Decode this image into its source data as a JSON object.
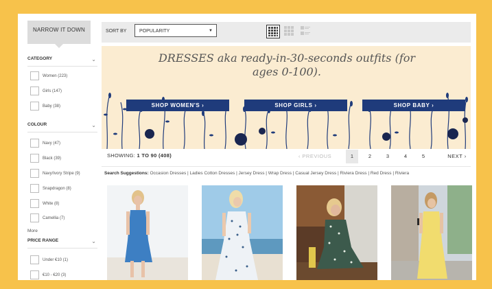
{
  "sidebar": {
    "narrow_title": "NARROW IT DOWN",
    "sections": [
      {
        "title": "CATEGORY",
        "options": [
          "Women (223)",
          "Girls (147)",
          "Baby (38)"
        ]
      },
      {
        "title": "COLOUR",
        "options": [
          "Navy (47)",
          "Black (39)",
          "Navy/Ivory Stripe (9)",
          "Snapdragon (8)",
          "White (8)",
          "Camellia (7)"
        ]
      },
      {
        "title": "PRICE RANGE",
        "options": [
          "Under €10 (1)",
          "€10 - €20 (3)"
        ]
      }
    ],
    "more_label": "More"
  },
  "toolbar": {
    "sort_label": "SORT BY",
    "sort_value": "POPULARITY"
  },
  "banner": {
    "title": "DRESSES aka ready-in-30-seconds outfits (for ages 0-100).",
    "buttons": [
      "SHOP WOMEN'S ›",
      "SHOP GIRLS ›",
      "SHOP BABY ›"
    ]
  },
  "pagination": {
    "showing_prefix": "SHOWING: ",
    "showing_range": "1 TO 90",
    "showing_total": " (408)",
    "previous": "‹  PREVIOUS",
    "pages": [
      "1",
      "2",
      "3",
      "4",
      "5"
    ],
    "next": "NEXT  ›"
  },
  "suggestions": {
    "label": "Search Suggestions:",
    "text": " Occasion Dresses | Ladies Cotton Dresses | Jersey Dress | Wrap Dress | Casual Jersey Dress | Riviera Dress | Red Dress | Riviera"
  },
  "colors": {
    "frame": "#f7c24b",
    "banner_bg": "#fbecd1",
    "button": "#1f3b7b"
  }
}
